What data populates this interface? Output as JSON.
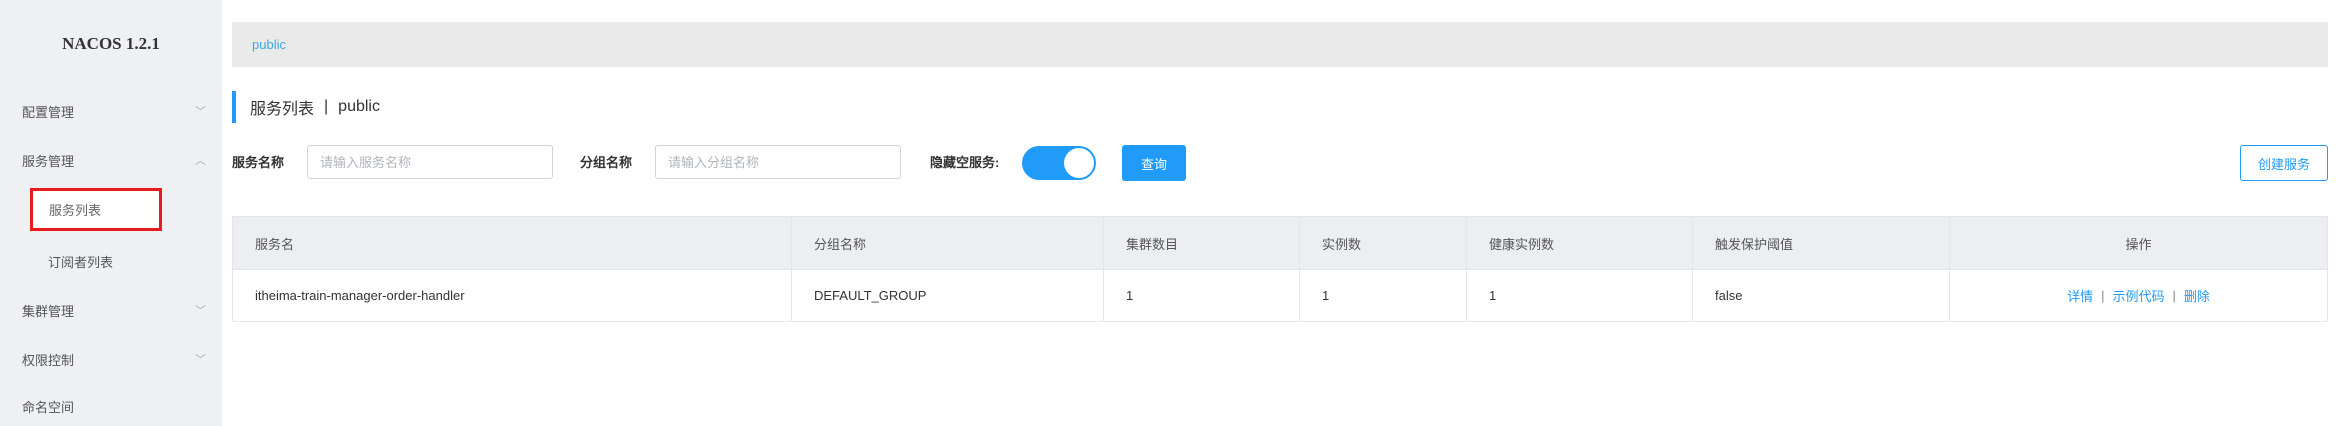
{
  "app": {
    "brand": "NACOS 1.2.1"
  },
  "sidebar": {
    "items": [
      {
        "label": "配置管理",
        "chevron": "chevron-down"
      },
      {
        "label": "服务管理",
        "chevron": "chevron-up"
      },
      {
        "label": "服务列表",
        "active": true
      },
      {
        "label": "订阅者列表"
      },
      {
        "label": "集群管理",
        "chevron": "chevron-down"
      },
      {
        "label": "权限控制",
        "chevron": "chevron-down"
      },
      {
        "label": "命名空间"
      }
    ]
  },
  "namespace_bar": {
    "label": "public"
  },
  "page": {
    "title": "服务列表",
    "separator": "|",
    "namespace": "public"
  },
  "filters": {
    "service_name_label": "服务名称",
    "service_name_placeholder": "请输入服务名称",
    "group_name_label": "分组名称",
    "group_name_placeholder": "请输入分组名称",
    "hide_empty_label": "隐藏空服务:",
    "hide_empty_enabled": true,
    "query_button": "查询",
    "create_button": "创建服务"
  },
  "table": {
    "columns": [
      "服务名",
      "分组名称",
      "集群数目",
      "实例数",
      "健康实例数",
      "触发保护阈值",
      "操作"
    ],
    "rows": [
      {
        "service": "itheima-train-manager-order-handler",
        "group": "DEFAULT_GROUP",
        "clusters": "1",
        "instances": "1",
        "healthy": "1",
        "threshold": "false",
        "actions": {
          "detail": "详情",
          "sep1": "|",
          "sample": "示例代码",
          "sep2": "|",
          "delete": "删除"
        }
      }
    ]
  },
  "colors": {
    "accent": "#209bfa",
    "highlight_box": "#e81c1c",
    "sidebar_bg": "#eef0f3"
  }
}
